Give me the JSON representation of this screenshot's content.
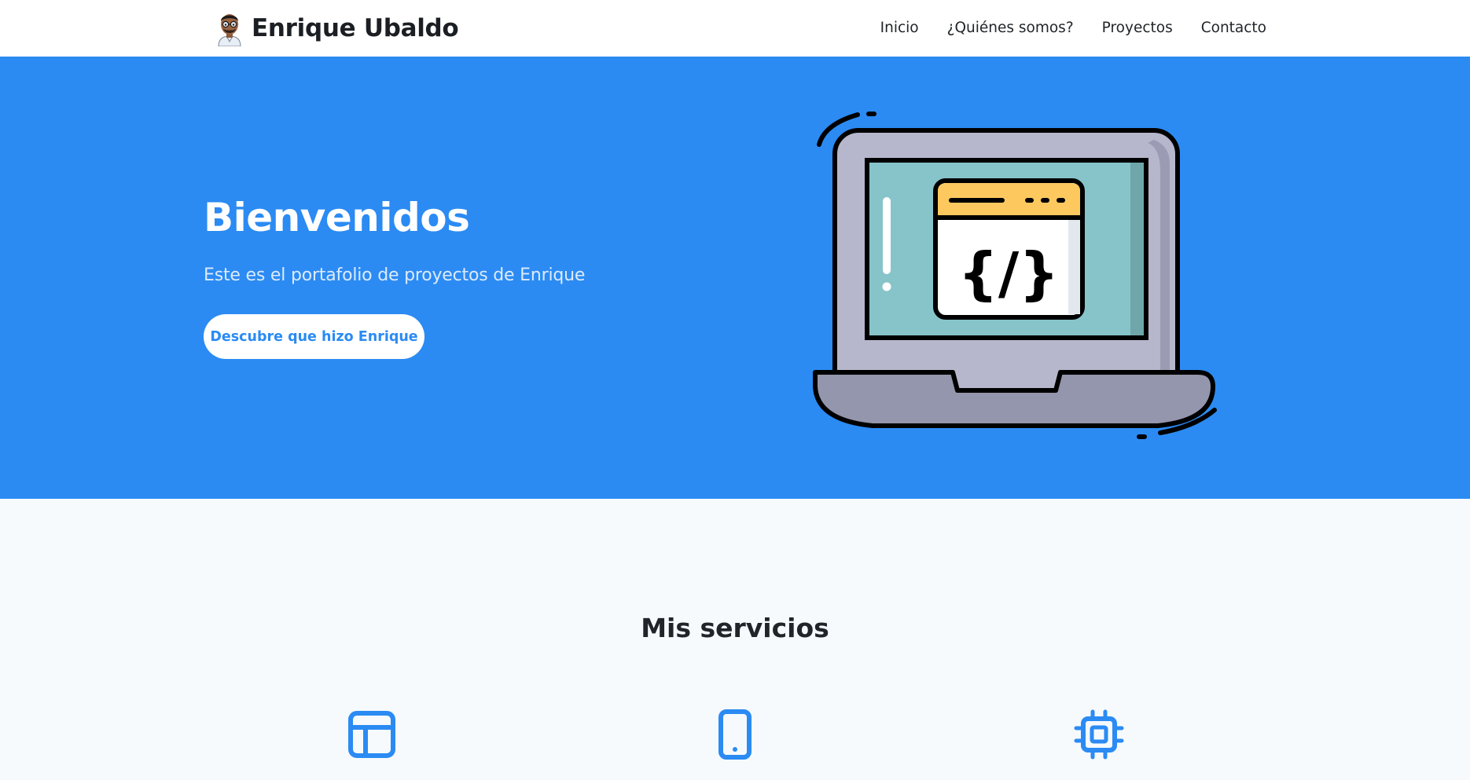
{
  "brand": {
    "name": "Enrique Ubaldo",
    "avatar_icon": "avatar-icon"
  },
  "nav": {
    "items": [
      {
        "label": "Inicio"
      },
      {
        "label": "¿Quiénes somos?"
      },
      {
        "label": "Proyectos"
      },
      {
        "label": "Contacto"
      }
    ]
  },
  "hero": {
    "title": "Bienvenidos",
    "subtitle": "Este es el portafolio de proyectos de Enrique",
    "button_label": "Descubre que hizo Enrique",
    "illustration_icon": "laptop-code-icon",
    "screen_code_text": "{/}"
  },
  "services": {
    "title": "Mis servicios",
    "icons": [
      "layout-icon",
      "mobile-icon",
      "cpu-chip-icon"
    ]
  },
  "colors": {
    "primary": "#2b8bf3",
    "nav_bg": "#ffffff",
    "page_bg": "#f6fafd",
    "text_dark": "#212529"
  }
}
